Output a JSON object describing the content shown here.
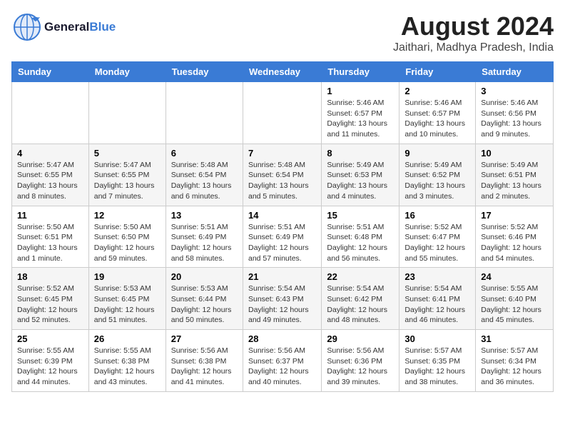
{
  "logo": {
    "general": "General",
    "blue": "Blue"
  },
  "header": {
    "month_year": "August 2024",
    "location": "Jaithari, Madhya Pradesh, India"
  },
  "days_of_week": [
    "Sunday",
    "Monday",
    "Tuesday",
    "Wednesday",
    "Thursday",
    "Friday",
    "Saturday"
  ],
  "weeks": [
    [
      {
        "day": "",
        "info": ""
      },
      {
        "day": "",
        "info": ""
      },
      {
        "day": "",
        "info": ""
      },
      {
        "day": "",
        "info": ""
      },
      {
        "day": "1",
        "info": "Sunrise: 5:46 AM\nSunset: 6:57 PM\nDaylight: 13 hours\nand 11 minutes."
      },
      {
        "day": "2",
        "info": "Sunrise: 5:46 AM\nSunset: 6:57 PM\nDaylight: 13 hours\nand 10 minutes."
      },
      {
        "day": "3",
        "info": "Sunrise: 5:46 AM\nSunset: 6:56 PM\nDaylight: 13 hours\nand 9 minutes."
      }
    ],
    [
      {
        "day": "4",
        "info": "Sunrise: 5:47 AM\nSunset: 6:55 PM\nDaylight: 13 hours\nand 8 minutes."
      },
      {
        "day": "5",
        "info": "Sunrise: 5:47 AM\nSunset: 6:55 PM\nDaylight: 13 hours\nand 7 minutes."
      },
      {
        "day": "6",
        "info": "Sunrise: 5:48 AM\nSunset: 6:54 PM\nDaylight: 13 hours\nand 6 minutes."
      },
      {
        "day": "7",
        "info": "Sunrise: 5:48 AM\nSunset: 6:54 PM\nDaylight: 13 hours\nand 5 minutes."
      },
      {
        "day": "8",
        "info": "Sunrise: 5:49 AM\nSunset: 6:53 PM\nDaylight: 13 hours\nand 4 minutes."
      },
      {
        "day": "9",
        "info": "Sunrise: 5:49 AM\nSunset: 6:52 PM\nDaylight: 13 hours\nand 3 minutes."
      },
      {
        "day": "10",
        "info": "Sunrise: 5:49 AM\nSunset: 6:51 PM\nDaylight: 13 hours\nand 2 minutes."
      }
    ],
    [
      {
        "day": "11",
        "info": "Sunrise: 5:50 AM\nSunset: 6:51 PM\nDaylight: 13 hours\nand 1 minute."
      },
      {
        "day": "12",
        "info": "Sunrise: 5:50 AM\nSunset: 6:50 PM\nDaylight: 12 hours\nand 59 minutes."
      },
      {
        "day": "13",
        "info": "Sunrise: 5:51 AM\nSunset: 6:49 PM\nDaylight: 12 hours\nand 58 minutes."
      },
      {
        "day": "14",
        "info": "Sunrise: 5:51 AM\nSunset: 6:49 PM\nDaylight: 12 hours\nand 57 minutes."
      },
      {
        "day": "15",
        "info": "Sunrise: 5:51 AM\nSunset: 6:48 PM\nDaylight: 12 hours\nand 56 minutes."
      },
      {
        "day": "16",
        "info": "Sunrise: 5:52 AM\nSunset: 6:47 PM\nDaylight: 12 hours\nand 55 minutes."
      },
      {
        "day": "17",
        "info": "Sunrise: 5:52 AM\nSunset: 6:46 PM\nDaylight: 12 hours\nand 54 minutes."
      }
    ],
    [
      {
        "day": "18",
        "info": "Sunrise: 5:52 AM\nSunset: 6:45 PM\nDaylight: 12 hours\nand 52 minutes."
      },
      {
        "day": "19",
        "info": "Sunrise: 5:53 AM\nSunset: 6:45 PM\nDaylight: 12 hours\nand 51 minutes."
      },
      {
        "day": "20",
        "info": "Sunrise: 5:53 AM\nSunset: 6:44 PM\nDaylight: 12 hours\nand 50 minutes."
      },
      {
        "day": "21",
        "info": "Sunrise: 5:54 AM\nSunset: 6:43 PM\nDaylight: 12 hours\nand 49 minutes."
      },
      {
        "day": "22",
        "info": "Sunrise: 5:54 AM\nSunset: 6:42 PM\nDaylight: 12 hours\nand 48 minutes."
      },
      {
        "day": "23",
        "info": "Sunrise: 5:54 AM\nSunset: 6:41 PM\nDaylight: 12 hours\nand 46 minutes."
      },
      {
        "day": "24",
        "info": "Sunrise: 5:55 AM\nSunset: 6:40 PM\nDaylight: 12 hours\nand 45 minutes."
      }
    ],
    [
      {
        "day": "25",
        "info": "Sunrise: 5:55 AM\nSunset: 6:39 PM\nDaylight: 12 hours\nand 44 minutes."
      },
      {
        "day": "26",
        "info": "Sunrise: 5:55 AM\nSunset: 6:38 PM\nDaylight: 12 hours\nand 43 minutes."
      },
      {
        "day": "27",
        "info": "Sunrise: 5:56 AM\nSunset: 6:38 PM\nDaylight: 12 hours\nand 41 minutes."
      },
      {
        "day": "28",
        "info": "Sunrise: 5:56 AM\nSunset: 6:37 PM\nDaylight: 12 hours\nand 40 minutes."
      },
      {
        "day": "29",
        "info": "Sunrise: 5:56 AM\nSunset: 6:36 PM\nDaylight: 12 hours\nand 39 minutes."
      },
      {
        "day": "30",
        "info": "Sunrise: 5:57 AM\nSunset: 6:35 PM\nDaylight: 12 hours\nand 38 minutes."
      },
      {
        "day": "31",
        "info": "Sunrise: 5:57 AM\nSunset: 6:34 PM\nDaylight: 12 hours\nand 36 minutes."
      }
    ]
  ]
}
